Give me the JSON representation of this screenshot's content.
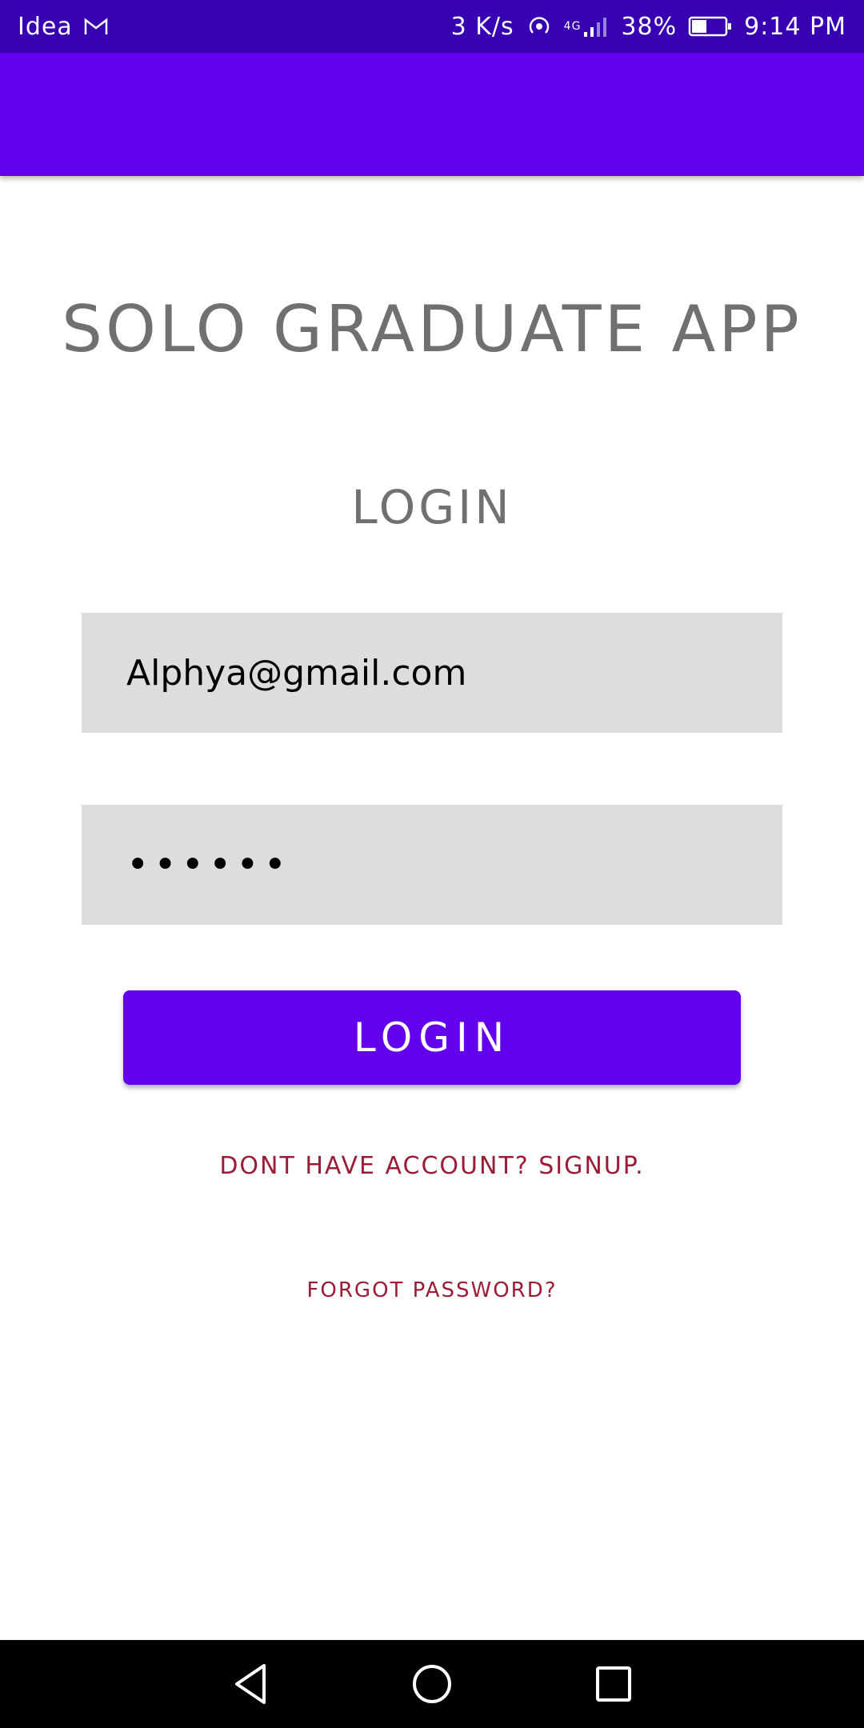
{
  "status_bar": {
    "carrier": "Idea",
    "network_speed": "3 K/s",
    "network_type": "4G",
    "battery": "38%",
    "time": "9:14 PM",
    "icons": [
      "gmail-icon",
      "hotspot-icon",
      "signal-icon",
      "battery-icon"
    ]
  },
  "app": {
    "title": "SOLO GRADUATE APP",
    "login_heading": "LOGIN"
  },
  "form": {
    "email_value": "Alphya@gmail.com",
    "password_value": "••••••",
    "login_button": "LOGIN",
    "signup_link": "DONT HAVE ACCOUNT? SIGNUP.",
    "forgot_link": "FORGOT PASSWORD?"
  },
  "colors": {
    "status_bar": "#3700b3",
    "primary": "#6200ee",
    "field_bg": "#dddddd",
    "title_text": "#707070",
    "link_text": "#9b1d35"
  },
  "nav": {
    "buttons": [
      "back-icon",
      "home-icon",
      "recents-icon"
    ]
  }
}
